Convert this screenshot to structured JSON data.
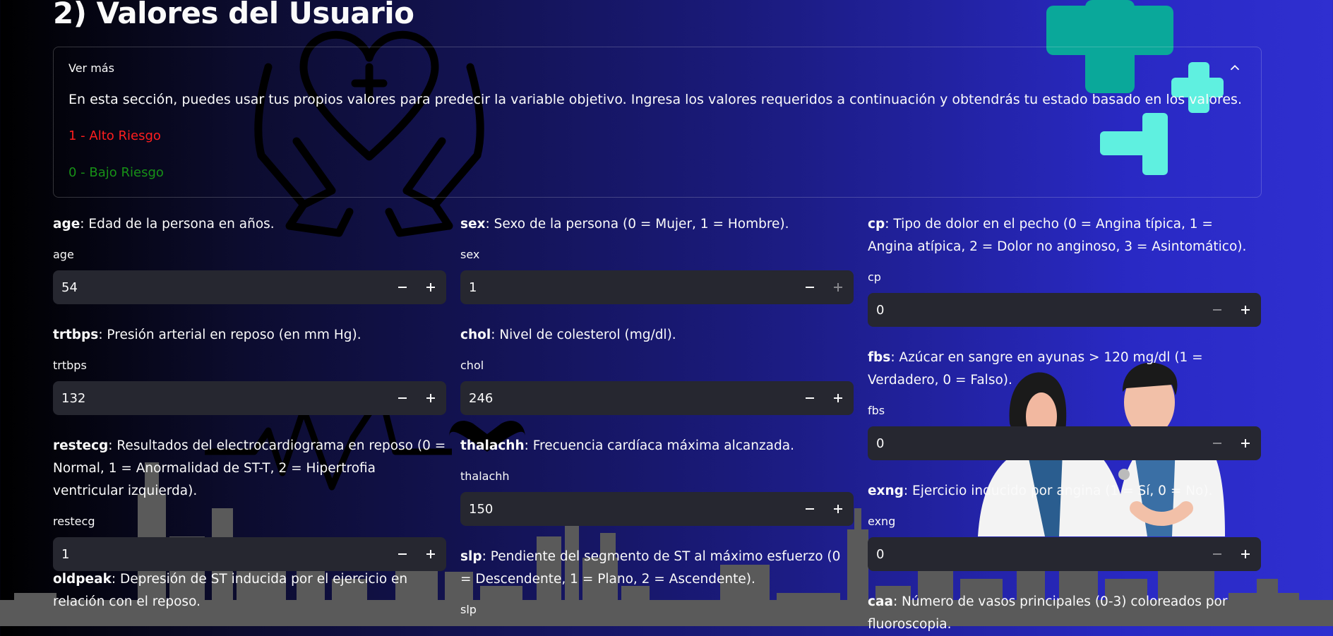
{
  "page": {
    "title": "2) Valores del Usuario"
  },
  "expander": {
    "header": "Ver más",
    "description": "En esta sección, puedes usar tus propios valores para predecir la variable objetivo. Ingresa los valores requeridos a continuación y obtendrás tu estado basado en los valores.",
    "high_risk": "1 - Alto Riesgo",
    "low_risk": "0 - Bajo Riesgo",
    "chevron_icon": "chevron-up-icon"
  },
  "colors": {
    "accent_high": "#ff1e1e",
    "accent_low": "#179117",
    "input_bg": "#262730"
  },
  "fields": {
    "age": {
      "key": "age",
      "desc": ": Edad de la persona en años.",
      "label": "age",
      "value": "54"
    },
    "sex": {
      "key": "sex",
      "desc": ": Sexo de la persona (0 = Mujer, 1 = Hombre).",
      "label": "sex",
      "value": "1"
    },
    "cp": {
      "key": "cp",
      "desc": ": Tipo de dolor en el pecho (0 = Angina típica, 1 = Angina atípica, 2 = Dolor no anginoso, 3 = Asintomático).",
      "label": "cp",
      "value": "0"
    },
    "trtbps": {
      "key": "trtbps",
      "desc": ": Presión arterial en reposo (en mm Hg).",
      "label": "trtbps",
      "value": "132"
    },
    "chol": {
      "key": "chol",
      "desc": ": Nivel de colesterol (mg/dl).",
      "label": "chol",
      "value": "246"
    },
    "fbs": {
      "key": "fbs",
      "desc": ": Azúcar en sangre en ayunas > 120 mg/dl (1 = Verdadero, 0 = Falso).",
      "label": "fbs",
      "value": "0"
    },
    "restecg": {
      "key": "restecg",
      "desc": ": Resultados del electrocardiograma en reposo (0 = Normal, 1 = Anormalidad de ST-T, 2 = Hipertrofia ventricular izquierda).",
      "label": "restecg",
      "value": "1"
    },
    "thalachh": {
      "key": "thalachh",
      "desc": ": Frecuencia cardíaca máxima alcanzada.",
      "label": "thalachh",
      "value": "150"
    },
    "exng": {
      "key": "exng",
      "desc": ": Ejercicio inducido por angina (1 = Sí, 0 = No).",
      "label": "exng",
      "value": "0"
    },
    "oldpeak": {
      "key": "oldpeak",
      "desc": ": Depresión de ST inducida por el ejercicio en relación con el reposo."
    },
    "slp": {
      "key": "slp",
      "desc": ": Pendiente del segmento de ST al máximo esfuerzo (0 = Descendente, 1 = Plano, 2 = Ascendente).",
      "label": "slp"
    },
    "caa": {
      "key": "caa",
      "desc": ": Número de vasos principales (0-3) coloreados por fluoroscopia."
    }
  },
  "icons": {
    "minus": "minus-icon",
    "plus": "plus-icon"
  }
}
